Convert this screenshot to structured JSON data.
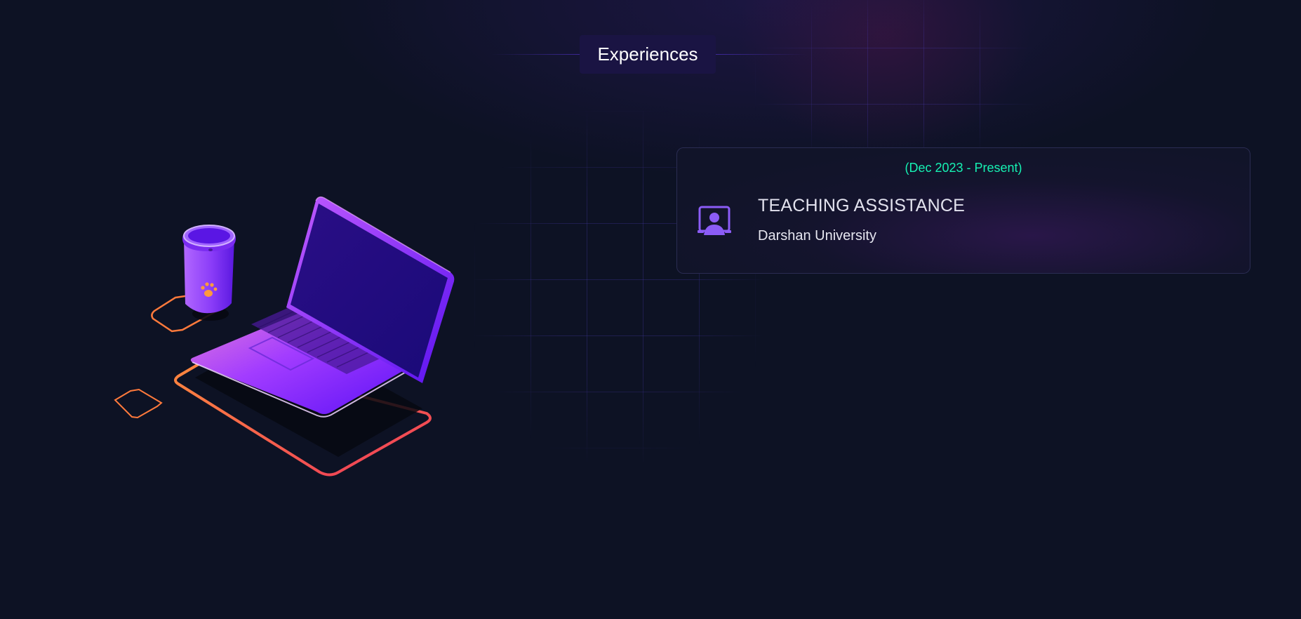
{
  "section": {
    "title": "Experiences"
  },
  "experiences": [
    {
      "period": "(Dec 2023 - Present)",
      "role": "TEACHING ASSISTANCE",
      "organization": "Darshan University",
      "icon": "presenter-icon"
    }
  ],
  "colors": {
    "background": "#0d1224",
    "accent": "#16f2b3",
    "title_bg": "#1a1443",
    "icon": "#8b5cf6"
  },
  "illustration": {
    "icon": "laptop-coffee-illustration"
  }
}
